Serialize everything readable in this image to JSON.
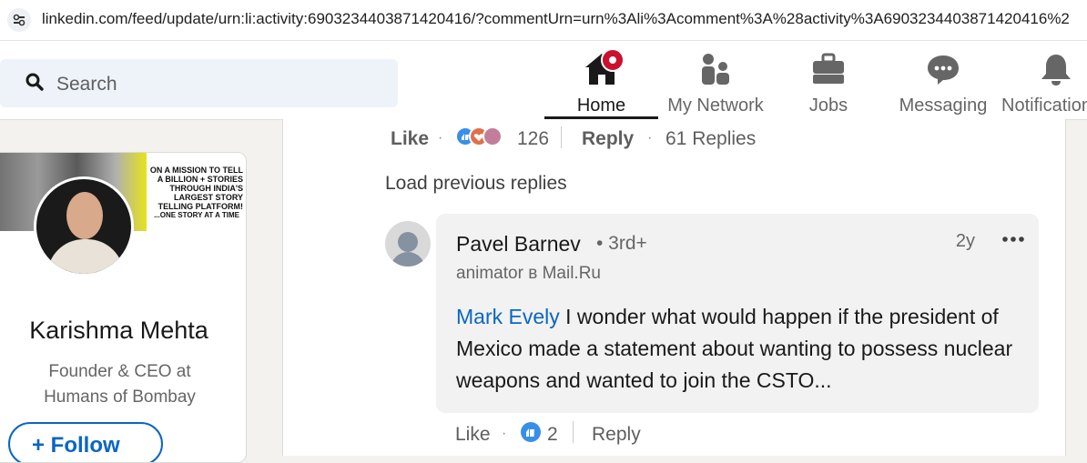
{
  "browser": {
    "url": "linkedin.com/feed/update/urn:li:activity:6903234403871420416/?commentUrn=urn%3Ali%3Acomment%3A%28activity%3A6903234403871420416%2"
  },
  "nav": {
    "search_placeholder": "Search",
    "items": [
      {
        "label": "Home",
        "icon": "home-icon",
        "active": true
      },
      {
        "label": "My Network",
        "icon": "network-icon"
      },
      {
        "label": "Jobs",
        "icon": "briefcase-icon"
      },
      {
        "label": "Messaging",
        "icon": "messaging-icon"
      },
      {
        "label": "Notifications",
        "icon": "bell-icon"
      }
    ],
    "home_badge_color": "#cb112d"
  },
  "profile": {
    "name": "Karishma Mehta",
    "headline": "Founder & CEO at Humans of Bombay",
    "follow_label": "+ Follow",
    "banner_text": "ON A MISSION TO TELL A BILLION + STORIES THROUGH INDIA'S LARGEST STORY TELLING PLATFORM!",
    "banner_tagline": "...ONE STORY AT A TIME"
  },
  "parent_actions": {
    "like": "Like",
    "reaction_count": "126",
    "reply": "Reply",
    "replies": "61 Replies"
  },
  "load_previous": "Load previous replies",
  "comment": {
    "author": "Pavel Barnev",
    "degree": "• 3rd+",
    "title": "animator в Mail.Ru",
    "time": "2y",
    "mention": "Mark Evely",
    "text": " I wonder what would happen if the president of Mexico made a statement about wanting to possess nuclear weapons and wanted to join the CSTO...",
    "like": "Like",
    "reaction_count": "2",
    "reply": "Reply"
  },
  "colors": {
    "accent": "#0a66c2",
    "background": "#f4f2ee"
  }
}
